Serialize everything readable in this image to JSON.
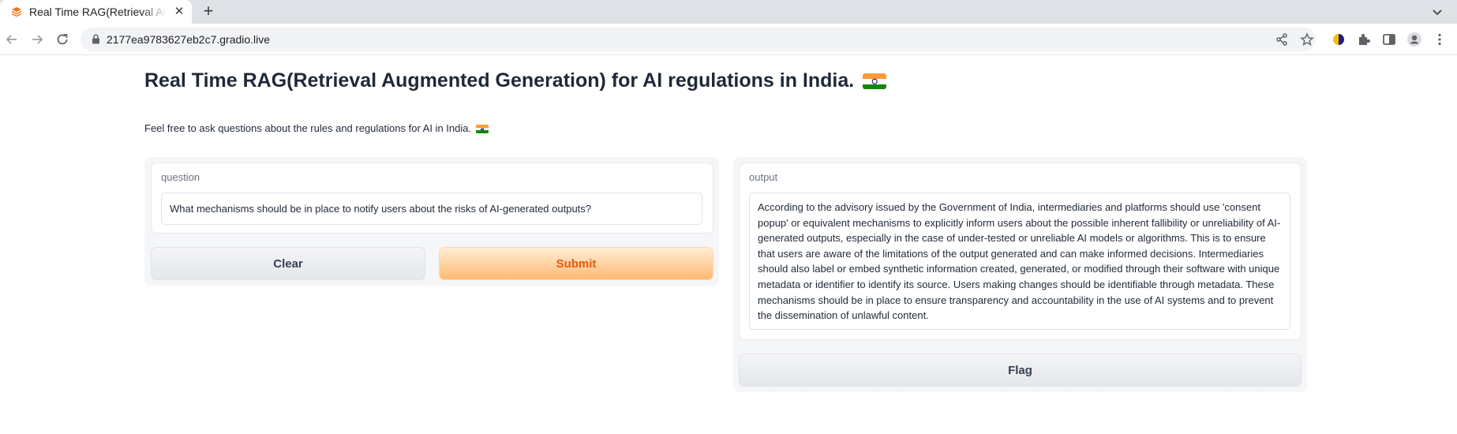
{
  "browser": {
    "tab_title": "Real Time RAG(Retrieval Augmented Generation) for AI regulations in India.",
    "url": "2177ea9783627eb2c7.gradio.live"
  },
  "page": {
    "title": "Real Time RAG(Retrieval Augmented Generation) for AI regulations in India.",
    "description": "Feel free to ask questions about the rules and regulations for AI in India.",
    "flag_emoji": "🇮🇳"
  },
  "input_panel": {
    "question_label": "question",
    "question_value": "What mechanisms should be in place to notify users about the risks of AI-generated outputs?",
    "clear_label": "Clear",
    "submit_label": "Submit"
  },
  "output_panel": {
    "output_label": "output",
    "output_value": "According to the advisory issued by the Government of India, intermediaries and platforms should use 'consent popup' or equivalent mechanisms to explicitly inform users about the possible inherent fallibility or unreliability of AI-generated outputs, especially in the case of under-tested or unreliable AI models or algorithms. This is to ensure that users are aware of the limitations of the output generated and can make informed decisions. Intermediaries should also label or embed synthetic information created, generated, or modified through their software with unique metadata or identifier to identify its source. Users making changes should be identifiable through metadata. These mechanisms should be in place to ensure transparency and accountability in the use of AI systems and to prevent the dissemination of unlawful content.",
    "flag_label": "Flag"
  },
  "colors": {
    "primary_button_text": "#ea580c",
    "primary_button_bg": "#fdba74"
  }
}
